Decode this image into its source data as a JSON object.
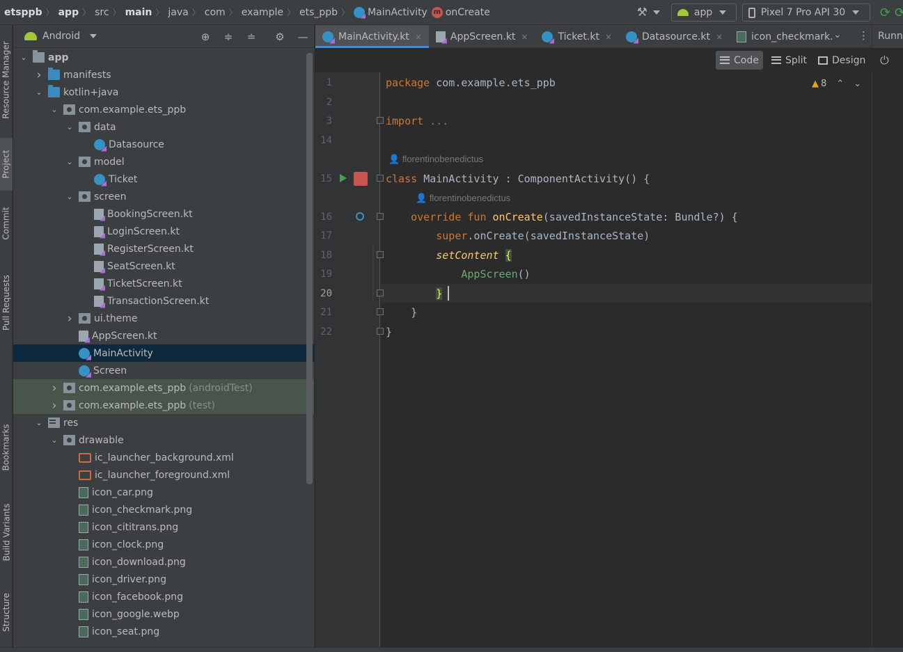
{
  "breadcrumbs": [
    {
      "label": "etsppb",
      "bold": true
    },
    {
      "label": "app",
      "bold": true
    },
    {
      "label": "src"
    },
    {
      "label": "main",
      "bold": true
    },
    {
      "label": "java"
    },
    {
      "label": "com"
    },
    {
      "label": "example"
    },
    {
      "label": "ets_ppb"
    },
    {
      "label": "MainActivity",
      "icon": "kotlin-class-icon"
    },
    {
      "label": "onCreate",
      "icon": "method-icon"
    }
  ],
  "method_badge": "m",
  "run_config": {
    "label": "app"
  },
  "device": {
    "label": "Pixel 7 Pro API 30"
  },
  "left_strip": {
    "resource_manager": "Resource Manager",
    "project": "Project",
    "commit": "Commit",
    "pull_requests": "Pull Requests",
    "bookmarks": "Bookmarks",
    "build_variants": "Build Variants",
    "structure": "Structure"
  },
  "project_panel": {
    "view_label": "Android"
  },
  "tree": [
    {
      "label": "app",
      "icon": "module-folder-icon",
      "arrow": "down",
      "depth": 0,
      "bold": true
    },
    {
      "label": "manifests",
      "icon": "folder-icon-blue",
      "arrow": "right",
      "depth": 1
    },
    {
      "label": "kotlin+java",
      "icon": "folder-icon-blue",
      "arrow": "down",
      "depth": 1
    },
    {
      "label": "com.example.ets_ppb",
      "icon": "package-icon",
      "arrow": "down",
      "depth": 2
    },
    {
      "label": "data",
      "icon": "package-icon",
      "arrow": "down",
      "depth": 3
    },
    {
      "label": "Datasource",
      "icon": "kotlin-class-icon",
      "arrow": "none",
      "depth": 4
    },
    {
      "label": "model",
      "icon": "package-icon",
      "arrow": "down",
      "depth": 3
    },
    {
      "label": "Ticket",
      "icon": "kotlin-class-icon",
      "arrow": "none",
      "depth": 4
    },
    {
      "label": "screen",
      "icon": "package-icon",
      "arrow": "down",
      "depth": 3
    },
    {
      "label": "BookingScreen.kt",
      "icon": "kotlin-file-icon",
      "arrow": "none",
      "depth": 4
    },
    {
      "label": "LoginScreen.kt",
      "icon": "kotlin-file-icon",
      "arrow": "none",
      "depth": 4
    },
    {
      "label": "RegisterScreen.kt",
      "icon": "kotlin-file-icon",
      "arrow": "none",
      "depth": 4
    },
    {
      "label": "SeatScreen.kt",
      "icon": "kotlin-file-icon",
      "arrow": "none",
      "depth": 4
    },
    {
      "label": "TicketScreen.kt",
      "icon": "kotlin-file-icon",
      "arrow": "none",
      "depth": 4
    },
    {
      "label": "TransactionScreen.kt",
      "icon": "kotlin-file-icon",
      "arrow": "none",
      "depth": 4
    },
    {
      "label": "ui.theme",
      "icon": "package-icon",
      "arrow": "right",
      "depth": 3
    },
    {
      "label": "AppScreen.kt",
      "icon": "kotlin-file-icon",
      "arrow": "none",
      "depth": 3
    },
    {
      "label": "MainActivity",
      "icon": "kotlin-class-icon",
      "arrow": "none",
      "depth": 3,
      "selected": true
    },
    {
      "label": "Screen",
      "icon": "kotlin-class-icon",
      "arrow": "none",
      "depth": 3
    },
    {
      "label": "com.example.ets_ppb",
      "suffix": "(androidTest)",
      "icon": "package-icon",
      "arrow": "right",
      "depth": 2,
      "test": true
    },
    {
      "label": "com.example.ets_ppb",
      "suffix": "(test)",
      "icon": "package-icon",
      "arrow": "right",
      "depth": 2,
      "test": true
    },
    {
      "label": "res",
      "icon": "res-folder-icon",
      "arrow": "down",
      "depth": 1
    },
    {
      "label": "drawable",
      "icon": "package-icon",
      "arrow": "down",
      "depth": 2
    },
    {
      "label": "ic_launcher_background.xml",
      "icon": "xml-file-icon",
      "arrow": "none",
      "depth": 3
    },
    {
      "label": "ic_launcher_foreground.xml",
      "icon": "xml-file-icon",
      "arrow": "none",
      "depth": 3
    },
    {
      "label": "icon_car.png",
      "icon": "image-file-icon",
      "arrow": "none",
      "depth": 3
    },
    {
      "label": "icon_checkmark.png",
      "icon": "image-file-icon",
      "arrow": "none",
      "depth": 3
    },
    {
      "label": "icon_cititrans.png",
      "icon": "image-file-icon",
      "arrow": "none",
      "depth": 3
    },
    {
      "label": "icon_clock.png",
      "icon": "image-file-icon",
      "arrow": "none",
      "depth": 3
    },
    {
      "label": "icon_download.png",
      "icon": "image-file-icon",
      "arrow": "none",
      "depth": 3
    },
    {
      "label": "icon_driver.png",
      "icon": "image-file-icon",
      "arrow": "none",
      "depth": 3
    },
    {
      "label": "icon_facebook.png",
      "icon": "image-file-icon",
      "arrow": "none",
      "depth": 3
    },
    {
      "label": "icon_google.webp",
      "icon": "image-file-icon",
      "arrow": "none",
      "depth": 3
    },
    {
      "label": "icon_seat.png",
      "icon": "image-file-icon",
      "arrow": "none",
      "depth": 3
    }
  ],
  "editor_tabs": [
    {
      "label": "MainActivity.kt",
      "icon": "kotlin-class-icon",
      "active": true,
      "close": "×"
    },
    {
      "label": "AppScreen.kt",
      "icon": "kotlin-file-icon",
      "close": "×"
    },
    {
      "label": "Ticket.kt",
      "icon": "kotlin-class-icon",
      "close": "×"
    },
    {
      "label": "Datasource.kt",
      "icon": "kotlin-class-icon",
      "close": "×"
    },
    {
      "label": "icon_checkmark.",
      "icon": "image-file-icon"
    }
  ],
  "running_label": "Runni",
  "view_modes": {
    "code": "Code",
    "split": "Split",
    "design": "Design"
  },
  "warnings": {
    "count": "8"
  },
  "code_lines": [
    {
      "num": "1",
      "parts": [
        {
          "t": "package ",
          "c": "kw"
        },
        {
          "t": "com.example.ets_ppb",
          "c": ""
        }
      ]
    },
    {
      "num": "2",
      "parts": []
    },
    {
      "num": "3",
      "parts": [
        {
          "t": "import ",
          "c": "kw"
        },
        {
          "t": "...",
          "c": "gr"
        }
      ]
    },
    {
      "num": "14",
      "parts": []
    },
    {
      "num": "15",
      "parts": [
        {
          "t": "class ",
          "c": "kw"
        },
        {
          "t": "MainActivity : ComponentActivity() {",
          "c": ""
        }
      ]
    },
    {
      "num": "16",
      "parts": [
        {
          "t": "    override fun ",
          "c": "kw"
        },
        {
          "t": "onCreate",
          "c": "fn"
        },
        {
          "t": "(savedInstanceState: Bundle?) {",
          "c": ""
        }
      ]
    },
    {
      "num": "17",
      "parts": [
        {
          "t": "        super",
          "c": "kw"
        },
        {
          "t": ".onCreate(savedInstanceState)",
          "c": ""
        }
      ]
    },
    {
      "num": "18",
      "parts": [
        {
          "t": "        ",
          "c": ""
        },
        {
          "t": "setContent",
          "c": "it"
        },
        {
          "t": " ",
          "c": ""
        },
        {
          "t": "{",
          "c": "brace"
        }
      ]
    },
    {
      "num": "19",
      "parts": [
        {
          "t": "            ",
          "c": ""
        },
        {
          "t": "AppScreen",
          "c": "ap"
        },
        {
          "t": "()",
          "c": ""
        }
      ]
    },
    {
      "num": "20",
      "parts": [
        {
          "t": "        ",
          "c": ""
        },
        {
          "t": "}",
          "c": "brace"
        }
      ]
    },
    {
      "num": "21",
      "parts": [
        {
          "t": "    }",
          "c": ""
        }
      ]
    },
    {
      "num": "22",
      "parts": [
        {
          "t": "}",
          "c": ""
        }
      ]
    }
  ],
  "author_hint": "florentinobenedictus"
}
